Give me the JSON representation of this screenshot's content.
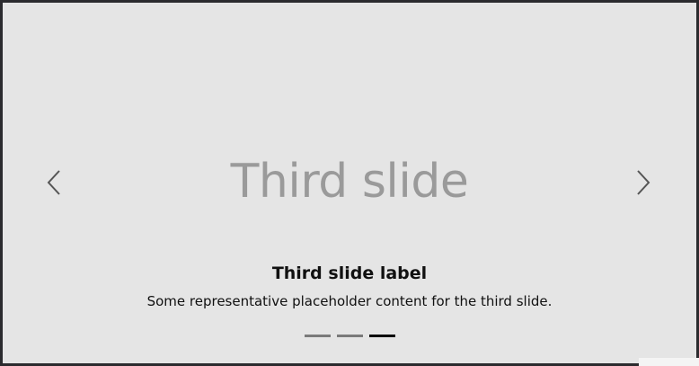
{
  "carousel": {
    "placeholder": "Third slide",
    "caption_title": "Third slide label",
    "caption_text": "Some representative placeholder content for the third slide.",
    "indicators": [
      {
        "label": "Slide 1",
        "active": false
      },
      {
        "label": "Slide 2",
        "active": false
      },
      {
        "label": "Slide 3",
        "active": true
      }
    ],
    "prev_icon": "chevron-left-icon",
    "next_icon": "chevron-right-icon"
  },
  "colors": {
    "background": "#e5e5e5",
    "placeholder_text": "#9a9a9a",
    "indicator_inactive": "#7a7a7a",
    "indicator_active": "#000000"
  }
}
